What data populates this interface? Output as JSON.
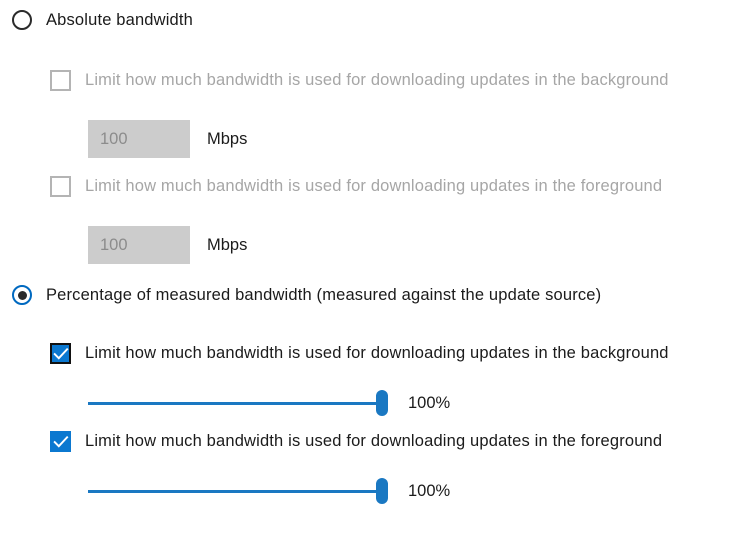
{
  "colors": {
    "accent": "#0b78d0",
    "slider": "#1a78c2",
    "disabled_text": "#a6a6a6",
    "text": "#1b1b1b",
    "input_bg": "#cccccc"
  },
  "absolute_section": {
    "radio": {
      "label": "Absolute bandwidth",
      "checked": false
    },
    "background_option": {
      "checkbox_label": "Limit how much bandwidth is used for downloading updates in the background",
      "checked": false,
      "enabled": false,
      "value": "100",
      "unit": "Mbps"
    },
    "foreground_option": {
      "checkbox_label": "Limit how much bandwidth is used for downloading updates in the foreground",
      "checked": false,
      "enabled": false,
      "value": "100",
      "unit": "Mbps"
    }
  },
  "percentage_section": {
    "radio": {
      "label": "Percentage of measured bandwidth (measured against the update source)",
      "checked": true
    },
    "background_option": {
      "checkbox_label": "Limit how much bandwidth is used for downloading updates in the background",
      "checked": true,
      "enabled": true,
      "slider_value": "100%",
      "slider_percent": 100
    },
    "foreground_option": {
      "checkbox_label": "Limit how much bandwidth is used for downloading updates in the foreground",
      "checked": true,
      "enabled": true,
      "slider_value": "100%",
      "slider_percent": 100
    }
  }
}
